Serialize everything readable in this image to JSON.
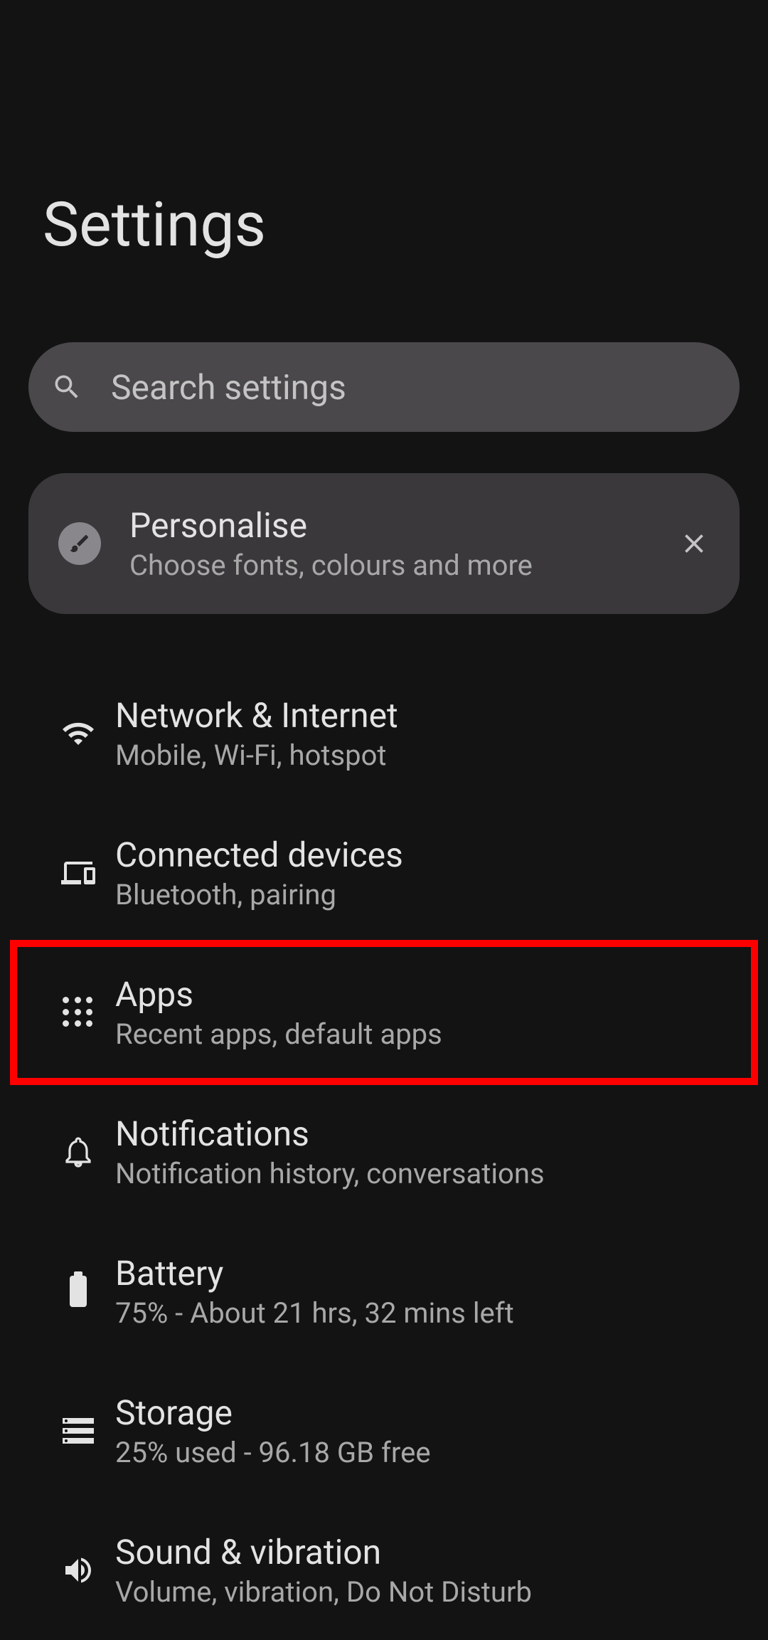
{
  "header": {
    "title": "Settings"
  },
  "search": {
    "placeholder": "Search settings"
  },
  "promo": {
    "title": "Personalise",
    "subtitle": "Choose fonts, colours and more"
  },
  "items": [
    {
      "title": "Network & Internet",
      "subtitle": "Mobile, Wi-Fi, hotspot"
    },
    {
      "title": "Connected devices",
      "subtitle": "Bluetooth, pairing"
    },
    {
      "title": "Apps",
      "subtitle": "Recent apps, default apps"
    },
    {
      "title": "Notifications",
      "subtitle": "Notification history, conversations"
    },
    {
      "title": "Battery",
      "subtitle": "75% - About 21 hrs, 32 mins left"
    },
    {
      "title": "Storage",
      "subtitle": "25% used - 96.18 GB free"
    },
    {
      "title": "Sound & vibration",
      "subtitle": "Volume, vibration, Do Not Disturb"
    }
  ]
}
